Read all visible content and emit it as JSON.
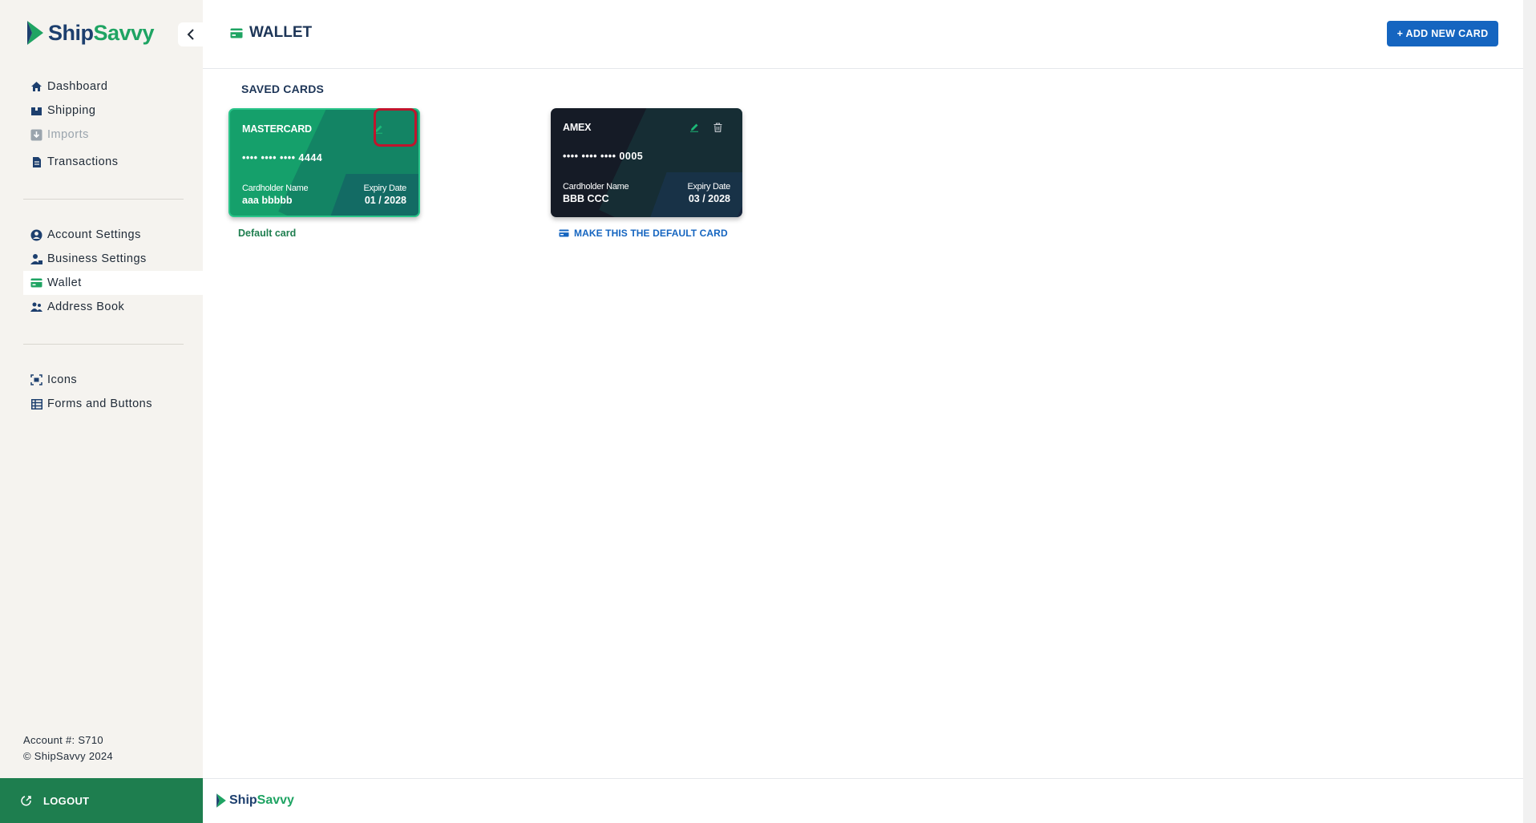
{
  "app": {
    "logo_ship": "Ship",
    "logo_savvy": "Savvy"
  },
  "sidebar": {
    "collapse_icon": "chevron-left-icon",
    "items_main": [
      {
        "label": "Dashboard",
        "icon": "home-icon"
      },
      {
        "label": "Shipping",
        "icon": "box-icon"
      },
      {
        "label": "Imports",
        "icon": "import-icon",
        "disabled": true
      },
      {
        "label": "Transactions",
        "icon": "document-icon"
      }
    ],
    "items_settings": [
      {
        "label": "Account Settings",
        "icon": "user-circle-icon"
      },
      {
        "label": "Business Settings",
        "icon": "business-user-icon"
      },
      {
        "label": "Wallet",
        "icon": "wallet-icon",
        "active": true
      },
      {
        "label": "Address Book",
        "icon": "address-book-icon"
      }
    ],
    "items_dev": [
      {
        "label": "Icons",
        "icon": "icons-icon"
      },
      {
        "label": "Forms and Buttons",
        "icon": "table-icon"
      }
    ],
    "account_number": "Account #: S710",
    "copyright": "© ShipSavvy 2024",
    "logout_label": "LOGOUT"
  },
  "header": {
    "title": "WALLET",
    "add_button_label": "+ ADD NEW CARD"
  },
  "main": {
    "section_title": "SAVED CARDS",
    "cards": [
      {
        "brand": "MASTERCARD",
        "number": "•••• •••• •••• 4444",
        "holder_label": "Cardholder Name",
        "holder": "aaa bbbbb",
        "expiry_label": "Expiry Date",
        "expiry": "01 / 2028",
        "is_default": true,
        "footer": "Default card"
      },
      {
        "brand": "AMEX",
        "number": "•••• •••• •••• 0005",
        "holder_label": "Cardholder Name",
        "holder": "BBB CCC",
        "expiry_label": "Expiry Date",
        "expiry": "03 / 2028",
        "is_default": false,
        "footer": "MAKE THIS THE DEFAULT CARD"
      }
    ]
  },
  "footer": {
    "logo_ship": "Ship",
    "logo_savvy": "Savvy"
  },
  "colors": {
    "brand_green": "#1e7e4f",
    "brand_blue": "#1565c0",
    "highlight_red": "#c0142c"
  }
}
